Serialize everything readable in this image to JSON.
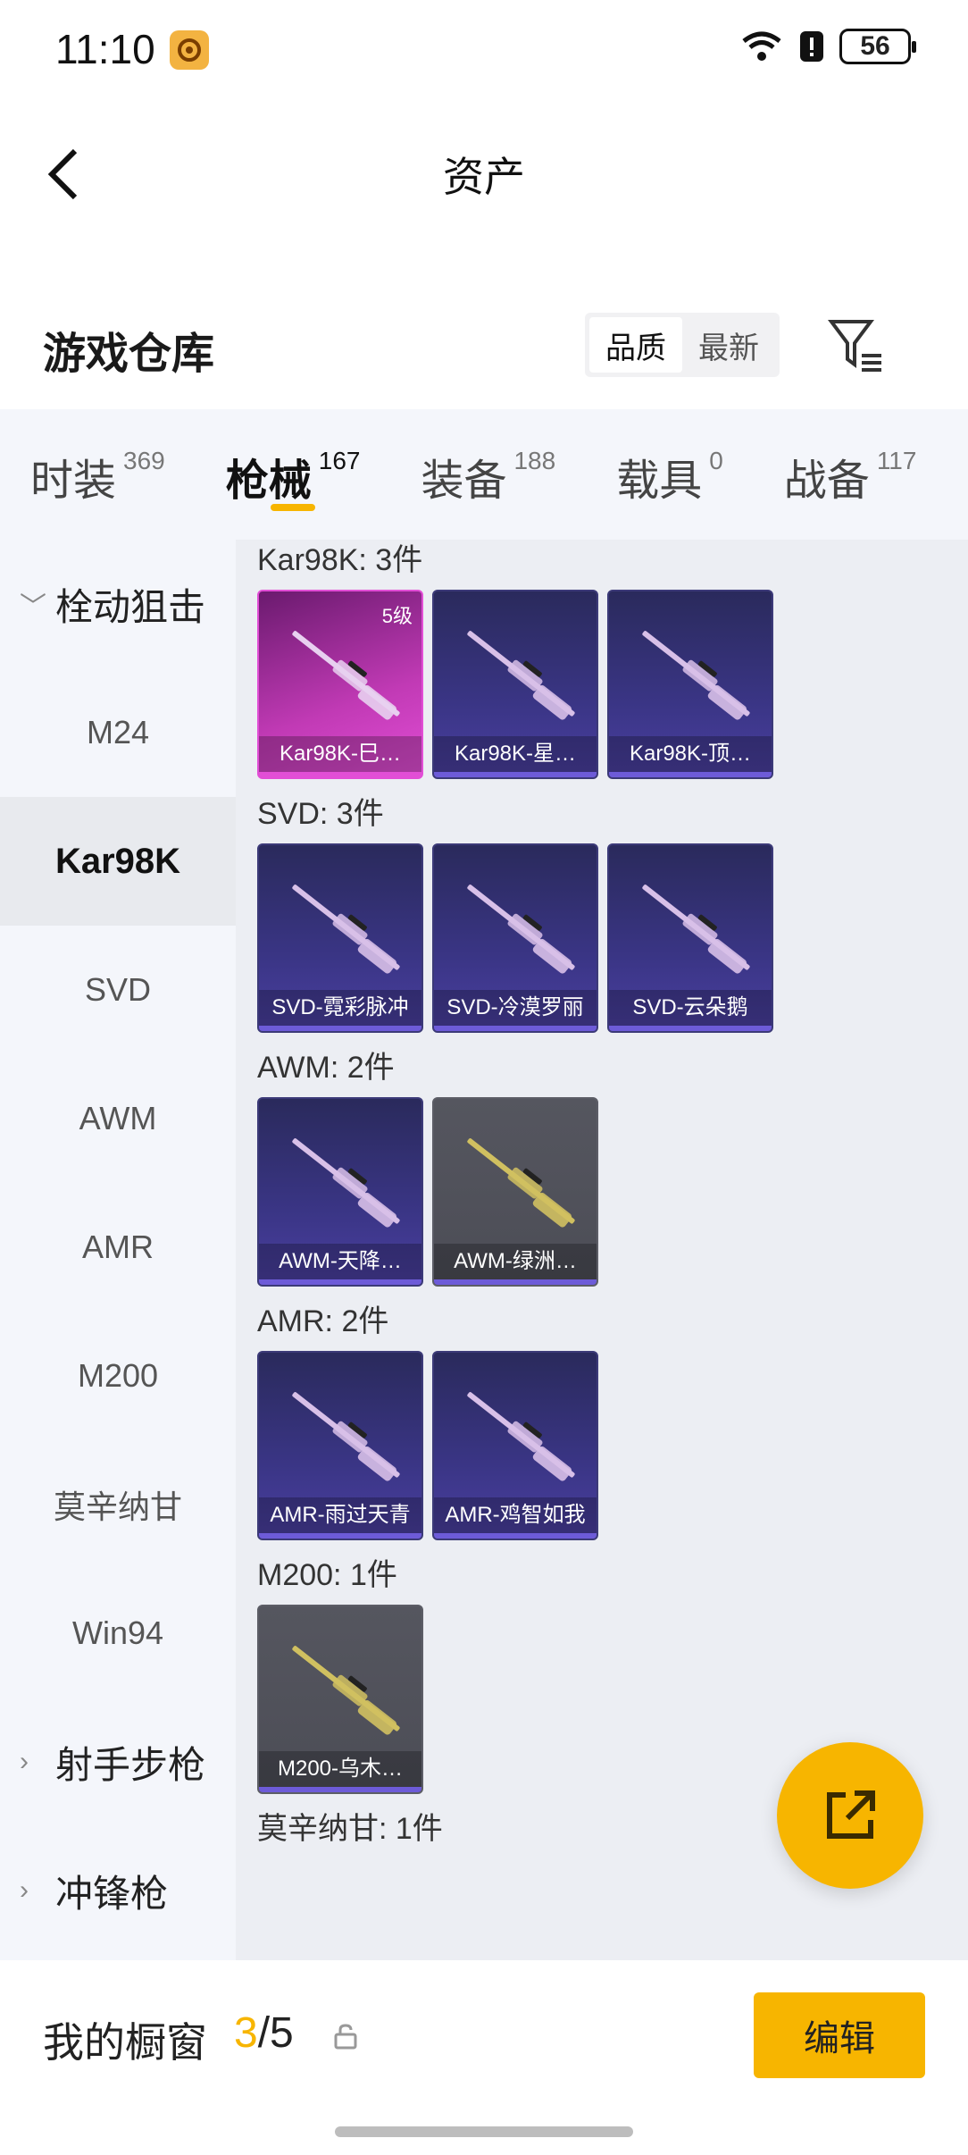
{
  "status_bar": {
    "time": "11:10",
    "battery": "56"
  },
  "nav": {
    "title": "资产"
  },
  "warehouse": {
    "title": "游戏仓库",
    "sort_options": [
      "品质",
      "最新"
    ],
    "active_sort": "品质"
  },
  "tabs": [
    {
      "label": "时装",
      "count": "369"
    },
    {
      "label": "枪械",
      "count": "167"
    },
    {
      "label": "装备",
      "count": "188"
    },
    {
      "label": "载具",
      "count": "0"
    },
    {
      "label": "战备",
      "count": "117"
    }
  ],
  "sidebar": {
    "group1": "栓动狙击",
    "items": [
      "M24",
      "Kar98K",
      "SVD",
      "AWM",
      "AMR",
      "M200",
      "莫辛纳甘",
      "Win94"
    ],
    "group2": "射手步枪",
    "group3": "冲锋枪"
  },
  "sections": [
    {
      "title": "Kar98K: 3件",
      "cards": [
        {
          "name": "Kar98K-巳…",
          "level": "5级",
          "style": "pink"
        },
        {
          "name": "Kar98K-星…",
          "style": "blue"
        },
        {
          "name": "Kar98K-顶…",
          "style": "blue"
        }
      ]
    },
    {
      "title": "SVD: 3件",
      "cards": [
        {
          "name": "SVD-霓彩脉冲",
          "style": "blue"
        },
        {
          "name": "SVD-冷漠罗丽",
          "style": "blue"
        },
        {
          "name": "SVD-云朵鹅",
          "style": "blue"
        }
      ]
    },
    {
      "title": "AWM: 2件",
      "cards": [
        {
          "name": "AWM-天降…",
          "style": "blue"
        },
        {
          "name": "AWM-绿洲…",
          "style": "gray"
        }
      ]
    },
    {
      "title": "AMR: 2件",
      "cards": [
        {
          "name": "AMR-雨过天青",
          "style": "blue"
        },
        {
          "name": "AMR-鸡智如我",
          "style": "blue"
        }
      ]
    },
    {
      "title": "M200: 1件",
      "cards": [
        {
          "name": "M200-乌木…",
          "style": "gray"
        }
      ]
    },
    {
      "title": "莫辛纳甘: 1件",
      "cards": []
    }
  ],
  "bottom": {
    "label": "我的橱窗",
    "current": "3",
    "total": "/5",
    "edit": "编辑"
  },
  "colors": {
    "accent": "#f7b500"
  }
}
